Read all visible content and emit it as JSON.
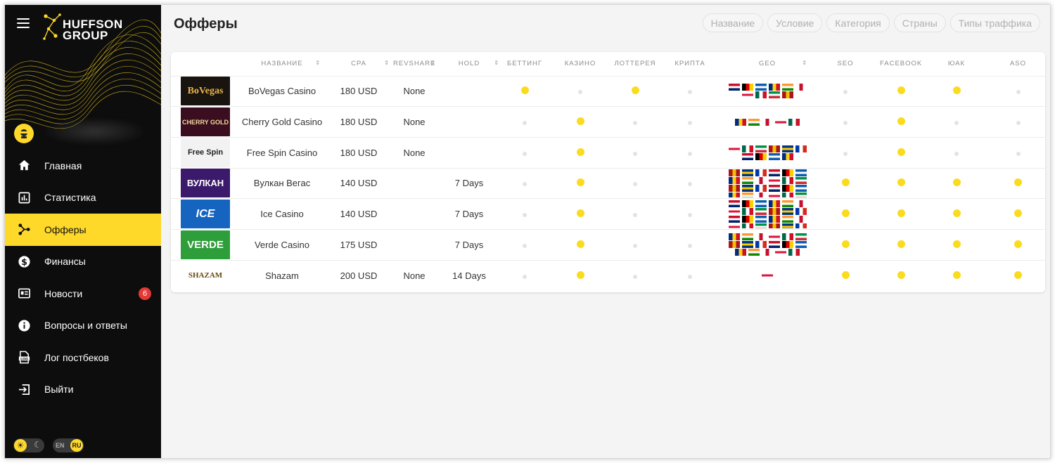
{
  "sidebar": {
    "logo_line1": "HUFFSON",
    "logo_line2": "GROUP",
    "nav": [
      {
        "label": "Главная",
        "icon": "home-icon",
        "active": false
      },
      {
        "label": "Статистика",
        "icon": "stats-icon",
        "active": false
      },
      {
        "label": "Офферы",
        "icon": "offers-icon",
        "active": true
      },
      {
        "label": "Финансы",
        "icon": "dollar-icon",
        "active": false
      },
      {
        "label": "Новости",
        "icon": "news-icon",
        "active": false,
        "badge": "6"
      },
      {
        "label": "Вопросы и ответы",
        "icon": "info-icon",
        "active": false
      },
      {
        "label": "Лог постбеков",
        "icon": "log-icon",
        "active": false
      },
      {
        "label": "Выйти",
        "icon": "logout-icon",
        "active": false
      }
    ],
    "lang_en": "EN",
    "lang_ru": "RU"
  },
  "page": {
    "title": "Офферы",
    "filters": [
      "Название",
      "Условие",
      "Категория",
      "Страны",
      "Типы траффика"
    ]
  },
  "table": {
    "columns": [
      "НАЗВАНИЕ",
      "CPA",
      "REVSHARE",
      "HOLD",
      "БЕТТИНГ",
      "КАЗИНО",
      "ЛОТТЕРЕЯ",
      "КРИПТА",
      "GEO",
      "SEO",
      "FACEBOOK",
      "ЮАК",
      "ASO"
    ],
    "rows": [
      {
        "logo": "BoVegas",
        "name": "BoVegas Casino",
        "cpa": "180 USD",
        "revshare": "None",
        "hold": "",
        "flags": [
          true,
          false,
          true,
          false,
          false,
          true,
          true,
          false
        ],
        "geo_count": 10
      },
      {
        "logo": "CHERRY GOLD",
        "name": "Cherry Gold Casino",
        "cpa": "180 USD",
        "revshare": "None",
        "hold": "",
        "flags": [
          false,
          true,
          false,
          false,
          false,
          true,
          false,
          false
        ],
        "geo_count": 5
      },
      {
        "logo": "Free Spin",
        "name": "Free Spin Casino",
        "cpa": "180 USD",
        "revshare": "None",
        "hold": "",
        "flags": [
          false,
          true,
          false,
          false,
          false,
          true,
          false,
          false
        ],
        "geo_count": 10
      },
      {
        "logo": "ВУЛКАН",
        "name": "Вулкан Вегас",
        "cpa": "140 USD",
        "revshare": "",
        "hold": "7 Days",
        "flags": [
          false,
          true,
          false,
          false,
          true,
          true,
          true,
          true
        ],
        "geo_count": 24
      },
      {
        "logo": "ICE",
        "name": "Ice Casino",
        "cpa": "140 USD",
        "revshare": "",
        "hold": "7 Days",
        "flags": [
          false,
          true,
          false,
          false,
          true,
          true,
          true,
          true
        ],
        "geo_count": 24
      },
      {
        "logo": "VERDE",
        "name": "Verde Casino",
        "cpa": "175 USD",
        "revshare": "",
        "hold": "7 Days",
        "flags": [
          false,
          true,
          false,
          false,
          true,
          true,
          true,
          true
        ],
        "geo_count": 17
      },
      {
        "logo": "SHAZAM",
        "name": "Shazam",
        "cpa": "200 USD",
        "revshare": "None",
        "hold": "14 Days",
        "flags": [
          false,
          true,
          false,
          false,
          true,
          true,
          true,
          true
        ],
        "geo_count": 1
      }
    ]
  },
  "colors": {
    "accent": "#ffd92a",
    "dot_on": "#fbdb1e",
    "dot_off": "#e3e3e3",
    "sidebar_bg": "#0d0d0d",
    "badge": "#e53935"
  }
}
